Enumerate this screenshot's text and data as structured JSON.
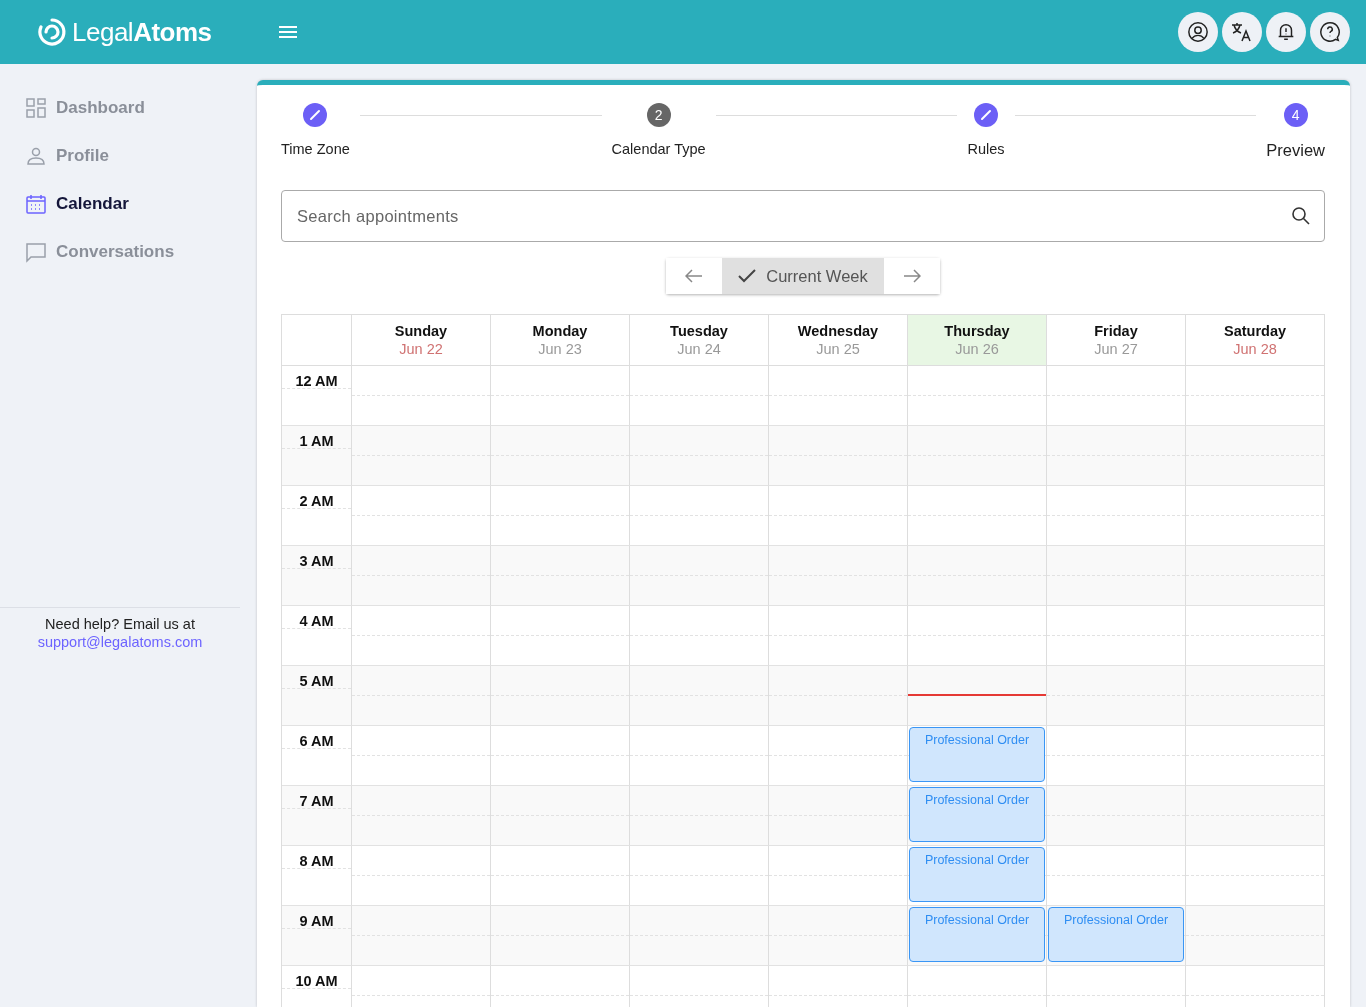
{
  "brand": {
    "light": "Legal",
    "bold": "Atoms"
  },
  "sidebar": {
    "items": [
      {
        "label": "Dashboard",
        "selected": false
      },
      {
        "label": "Profile",
        "selected": false
      },
      {
        "label": "Calendar",
        "selected": true
      },
      {
        "label": "Conversations",
        "selected": false
      }
    ],
    "help": {
      "text": "Need help? Email us at",
      "link": "support@legalatoms.com"
    }
  },
  "stepper": [
    {
      "label": "Time Zone",
      "kind": "edited"
    },
    {
      "label": "Calendar Type",
      "kind": "numbered",
      "number": "2",
      "current": false
    },
    {
      "label": "Rules",
      "kind": "edited"
    },
    {
      "label": "Preview",
      "kind": "numbered",
      "number": "4",
      "current": true
    }
  ],
  "search": {
    "placeholder": "Search appointments"
  },
  "week_nav": {
    "label": "Current Week",
    "selected": true
  },
  "days": [
    {
      "name": "Sunday",
      "date": "Jun 22",
      "weekend": true,
      "today": false
    },
    {
      "name": "Monday",
      "date": "Jun 23",
      "weekend": false,
      "today": false
    },
    {
      "name": "Tuesday",
      "date": "Jun 24",
      "weekend": false,
      "today": false
    },
    {
      "name": "Wednesday",
      "date": "Jun 25",
      "weekend": false,
      "today": false
    },
    {
      "name": "Thursday",
      "date": "Jun 26",
      "weekend": false,
      "today": true
    },
    {
      "name": "Friday",
      "date": "Jun 27",
      "weekend": false,
      "today": false
    },
    {
      "name": "Saturday",
      "date": "Jun 28",
      "weekend": true,
      "today": false
    }
  ],
  "hours": [
    {
      "label": "12 AM",
      "cells": [
        {
          "kind": "free"
        },
        {
          "kind": "free"
        },
        {
          "kind": "free"
        },
        {
          "kind": "free"
        },
        {
          "kind": "free"
        },
        {
          "kind": "free"
        },
        {
          "kind": "free"
        }
      ]
    },
    {
      "label": "1 AM",
      "cells": [
        {
          "kind": "free"
        },
        {
          "kind": "free"
        },
        {
          "kind": "free"
        },
        {
          "kind": "free"
        },
        {
          "kind": "free"
        },
        {
          "kind": "free"
        },
        {
          "kind": "free"
        }
      ]
    },
    {
      "label": "2 AM",
      "cells": [
        {
          "kind": "free"
        },
        {
          "kind": "free"
        },
        {
          "kind": "free"
        },
        {
          "kind": "free"
        },
        {
          "kind": "free"
        },
        {
          "kind": "free"
        },
        {
          "kind": "free"
        }
      ]
    },
    {
      "label": "3 AM",
      "cells": [
        {
          "kind": "free"
        },
        {
          "kind": "free"
        },
        {
          "kind": "free"
        },
        {
          "kind": "free"
        },
        {
          "kind": "free"
        },
        {
          "kind": "free"
        },
        {
          "kind": "free"
        }
      ]
    },
    {
      "label": "4 AM",
      "cells": [
        {
          "kind": "free"
        },
        {
          "kind": "free"
        },
        {
          "kind": "free"
        },
        {
          "kind": "free"
        },
        {
          "kind": "free"
        },
        {
          "kind": "free"
        },
        {
          "kind": "free"
        }
      ]
    },
    {
      "label": "5 AM",
      "now": true,
      "cells": [
        {
          "kind": "free"
        },
        {
          "kind": "free"
        },
        {
          "kind": "free"
        },
        {
          "kind": "free"
        },
        {
          "kind": "free"
        },
        {
          "kind": "free"
        },
        {
          "kind": "free"
        }
      ]
    },
    {
      "label": "6 AM",
      "cells": [
        {
          "kind": "free"
        },
        {
          "kind": "free"
        },
        {
          "kind": "free"
        },
        {
          "kind": "free"
        },
        {
          "kind": "appointment",
          "title": "Professional Order"
        },
        {
          "kind": "free"
        },
        {
          "kind": "free"
        }
      ]
    },
    {
      "label": "7 AM",
      "cells": [
        {
          "kind": "free"
        },
        {
          "kind": "free"
        },
        {
          "kind": "free"
        },
        {
          "kind": "free"
        },
        {
          "kind": "appointment",
          "title": "Professional Order"
        },
        {
          "kind": "free"
        },
        {
          "kind": "free"
        }
      ]
    },
    {
      "label": "8 AM",
      "cells": [
        {
          "kind": "free"
        },
        {
          "kind": "free"
        },
        {
          "kind": "free"
        },
        {
          "kind": "free"
        },
        {
          "kind": "appointment",
          "title": "Professional Order"
        },
        {
          "kind": "free"
        },
        {
          "kind": "free"
        }
      ]
    },
    {
      "label": "9 AM",
      "cells": [
        {
          "kind": "free"
        },
        {
          "kind": "free"
        },
        {
          "kind": "free"
        },
        {
          "kind": "free"
        },
        {
          "kind": "appointment",
          "title": "Professional Order"
        },
        {
          "kind": "appointment",
          "title": "Professional Order"
        },
        {
          "kind": "free"
        }
      ]
    },
    {
      "label": "10 AM",
      "cells": [
        {
          "kind": "free"
        },
        {
          "kind": "free"
        },
        {
          "kind": "free"
        },
        {
          "kind": "free"
        },
        {
          "kind": "free"
        },
        {
          "kind": "free"
        },
        {
          "kind": "free"
        }
      ]
    }
  ]
}
